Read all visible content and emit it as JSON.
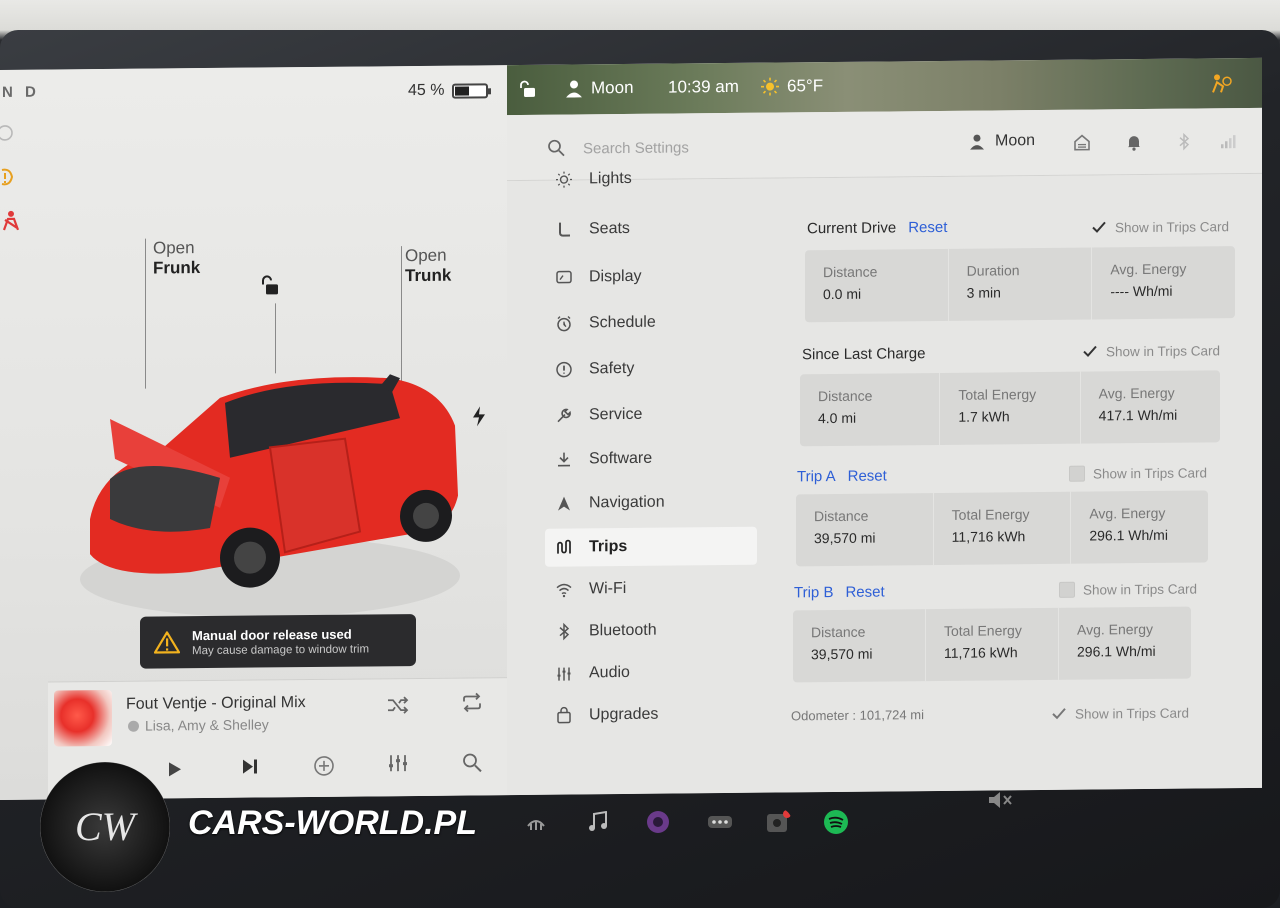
{
  "car": {
    "gear_letters": "N D",
    "battery_percent_text": "45 %",
    "battery_level": 0.45,
    "frunk": {
      "line1": "Open",
      "line2": "Frunk"
    },
    "trunk": {
      "line1": "Open",
      "line2": "Trunk"
    },
    "alert": {
      "title": "Manual door release used",
      "subtitle": "May cause damage to window trim"
    },
    "accent_color": "#e32b22"
  },
  "media": {
    "track_title": "Fout Ventje - Original Mix",
    "artist": "Lisa, Amy & Shelley"
  },
  "status_bar": {
    "profile": "Moon",
    "time": "10:39 am",
    "temperature": "65°F"
  },
  "settings_header": {
    "search_placeholder": "Search Settings",
    "profile_name": "Moon"
  },
  "sidebar": {
    "items": [
      {
        "label": "Lights",
        "icon": "light-bulb-icon"
      },
      {
        "label": "Seats",
        "icon": "seat-icon"
      },
      {
        "label": "Display",
        "icon": "display-icon"
      },
      {
        "label": "Schedule",
        "icon": "clock-icon"
      },
      {
        "label": "Safety",
        "icon": "safety-icon"
      },
      {
        "label": "Service",
        "icon": "wrench-icon"
      },
      {
        "label": "Software",
        "icon": "download-icon"
      },
      {
        "label": "Navigation",
        "icon": "navigation-icon"
      },
      {
        "label": "Trips",
        "icon": "trips-icon",
        "active": true
      },
      {
        "label": "Wi-Fi",
        "icon": "wifi-icon"
      },
      {
        "label": "Bluetooth",
        "icon": "bluetooth-icon"
      },
      {
        "label": "Audio",
        "icon": "equalizer-icon"
      },
      {
        "label": "Upgrades",
        "icon": "shopping-bag-icon"
      }
    ]
  },
  "trips": {
    "show_in_trips_card": "Show in Trips Card",
    "reset": "Reset",
    "current_drive": {
      "title": "Current Drive",
      "show_checked": true,
      "stats": [
        {
          "label": "Distance",
          "value": "0.0  mi"
        },
        {
          "label": "Duration",
          "value": "3  min"
        },
        {
          "label": "Avg. Energy",
          "value": "----  Wh/mi"
        }
      ]
    },
    "since_last_charge": {
      "title": "Since Last Charge",
      "show_checked": true,
      "stats": [
        {
          "label": "Distance",
          "value": "4.0  mi"
        },
        {
          "label": "Total Energy",
          "value": "1.7  kWh"
        },
        {
          "label": "Avg. Energy",
          "value": "417.1  Wh/mi"
        }
      ]
    },
    "trip_a": {
      "title": "Trip A",
      "show_checked": false,
      "stats": [
        {
          "label": "Distance",
          "value": "39,570  mi"
        },
        {
          "label": "Total Energy",
          "value": "11,716  kWh"
        },
        {
          "label": "Avg. Energy",
          "value": "296.1  Wh/mi"
        }
      ]
    },
    "trip_b": {
      "title": "Trip B",
      "show_checked": false,
      "stats": [
        {
          "label": "Distance",
          "value": "39,570  mi"
        },
        {
          "label": "Total Energy",
          "value": "11,716  kWh"
        },
        {
          "label": "Avg. Energy",
          "value": "296.1  Wh/mi"
        }
      ]
    },
    "odometer": "Odometer :  101,724  mi",
    "odometer_show_checked": true
  },
  "watermark": {
    "text": "CARS-WORLD.PL",
    "logo_text": "CW"
  }
}
